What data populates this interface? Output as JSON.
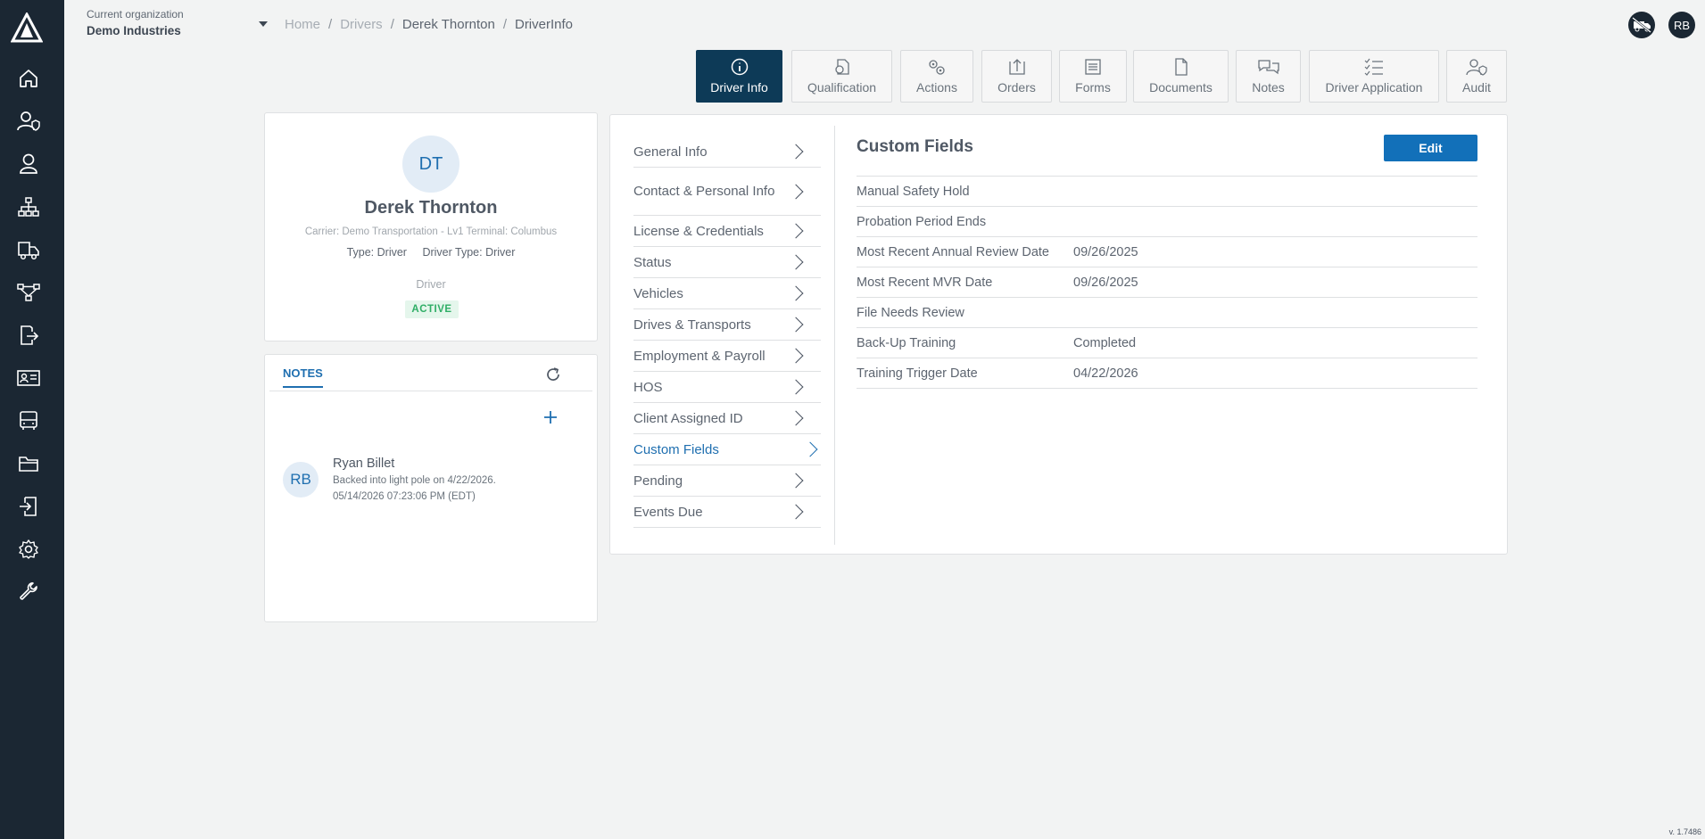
{
  "header": {
    "org_label": "Current organization",
    "org_name": "Demo Industries",
    "breadcrumb": [
      "Home",
      "Drivers",
      "Derek Thornton",
      "DriverInfo"
    ],
    "user_initials": "RB"
  },
  "sidebar": {
    "items": [
      "home-icon",
      "user-shield-icon",
      "person-icon",
      "org-chart-icon",
      "truck-icon",
      "network-icon",
      "export-icon",
      "id-card-icon",
      "bus-icon",
      "folder-icon",
      "import-icon",
      "settings-icon",
      "wrench-icon"
    ]
  },
  "tabs": [
    "Driver Info",
    "Qualification",
    "Actions",
    "Orders",
    "Forms",
    "Documents",
    "Notes",
    "Driver Application",
    "Audit"
  ],
  "profile": {
    "initials": "DT",
    "name": "Derek Thornton",
    "carrier": "Carrier: Demo Transportation - Lv1 Terminal: Columbus",
    "type": "Type: Driver",
    "driver_type": "Driver Type: Driver",
    "role": "Driver",
    "status": "ACTIVE"
  },
  "notes": {
    "tab_label": "NOTES",
    "items": [
      {
        "initials": "RB",
        "author": "Ryan Billet",
        "text": "Backed into light pole on 4/22/2026.",
        "timestamp": "05/14/2026 07:23:06 PM (EDT)"
      }
    ]
  },
  "menu": [
    "General Info",
    "Contact & Personal Info",
    "License & Credentials",
    "Status",
    "Vehicles",
    "Drives & Transports",
    "Employment & Payroll",
    "HOS",
    "Client Assigned ID",
    "Custom Fields",
    "Pending",
    "Events Due"
  ],
  "custom_fields": {
    "title": "Custom Fields",
    "edit_label": "Edit",
    "rows": [
      {
        "label": "Manual Safety Hold",
        "value": ""
      },
      {
        "label": "Probation Period Ends",
        "value": ""
      },
      {
        "label": "Most Recent Annual Review Date",
        "value": "09/26/2025"
      },
      {
        "label": "Most Recent MVR Date",
        "value": "09/26/2025"
      },
      {
        "label": "File Needs Review",
        "value": ""
      },
      {
        "label": "Back-Up Training",
        "value": "Completed"
      },
      {
        "label": "Training Trigger Date",
        "value": "04/22/2026"
      }
    ]
  },
  "version": "v. 1.7486",
  "colors": {
    "sidebar": "#1b2733",
    "active_tab": "#0d3a57",
    "accent": "#1f6fb0",
    "button": "#1270b9",
    "status_active": "#2fae66"
  }
}
